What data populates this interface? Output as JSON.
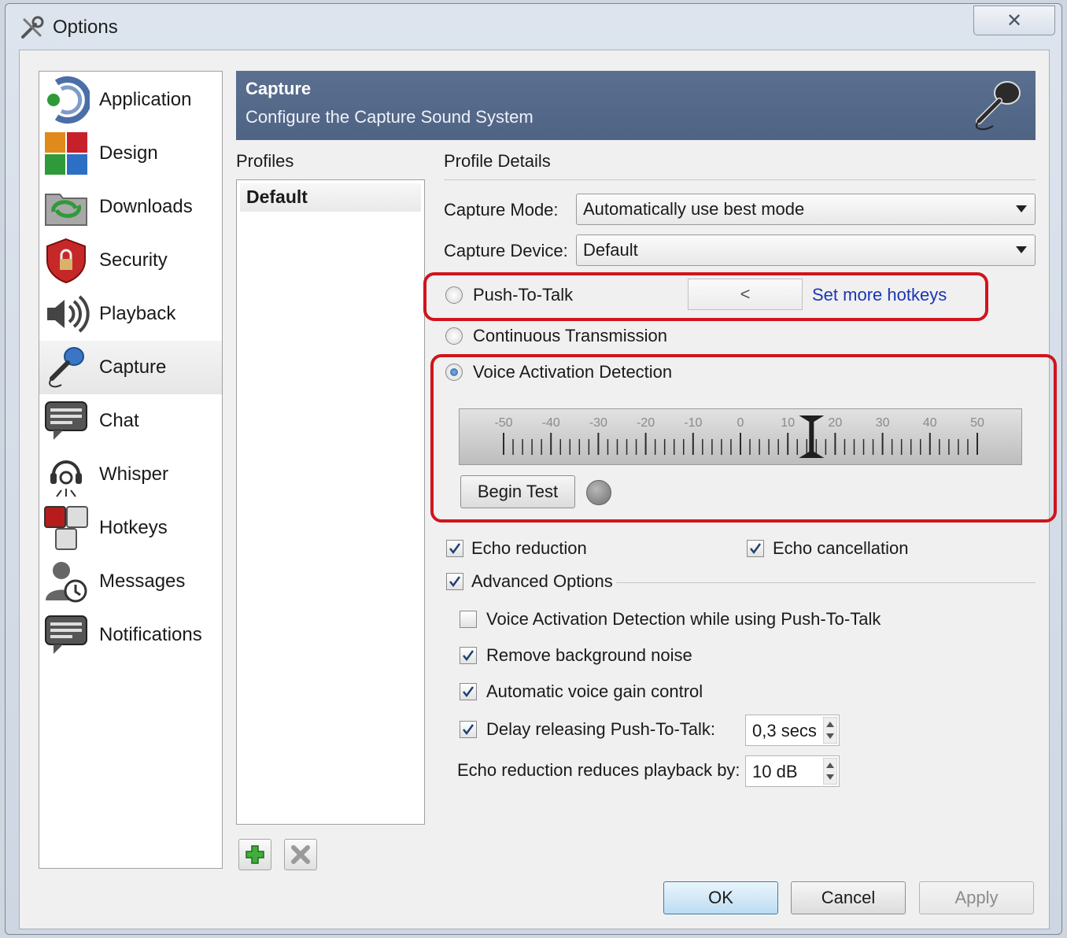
{
  "window": {
    "title": "Options",
    "close_glyph": "✕"
  },
  "sidebar": {
    "items": [
      {
        "label": "Application",
        "icon": "application-icon"
      },
      {
        "label": "Design",
        "icon": "design-icon"
      },
      {
        "label": "Downloads",
        "icon": "downloads-icon"
      },
      {
        "label": "Security",
        "icon": "security-icon"
      },
      {
        "label": "Playback",
        "icon": "playback-icon"
      },
      {
        "label": "Capture",
        "icon": "capture-microphone-icon",
        "selected": true
      },
      {
        "label": "Chat",
        "icon": "chat-icon"
      },
      {
        "label": "Whisper",
        "icon": "whisper-headset-icon"
      },
      {
        "label": "Hotkeys",
        "icon": "hotkeys-icon"
      },
      {
        "label": "Messages",
        "icon": "messages-icon"
      },
      {
        "label": "Notifications",
        "icon": "notifications-icon"
      }
    ]
  },
  "header": {
    "title": "Capture",
    "subtitle": "Configure the Capture Sound System"
  },
  "profiles": {
    "label": "Profiles",
    "items": [
      "Default"
    ]
  },
  "details": {
    "label": "Profile Details",
    "capture_mode": {
      "label": "Capture Mode:",
      "value": "Automatically use best mode"
    },
    "capture_device": {
      "label": "Capture Device:",
      "value": "Default"
    },
    "push_to_talk": {
      "label": "Push-To-Talk",
      "hotkey": "<",
      "link": "Set more hotkeys",
      "selected": false
    },
    "continuous": {
      "label": "Continuous Transmission",
      "selected": false
    },
    "vad": {
      "label": "Voice Activation Detection",
      "selected": true
    },
    "slider": {
      "ticks": [
        "-50",
        "-40",
        "-30",
        "-20",
        "-10",
        "0",
        "10",
        "20",
        "30",
        "40",
        "50"
      ],
      "value": 15
    },
    "begin_test": "Begin Test",
    "echo_reduction": {
      "label": "Echo reduction",
      "checked": true
    },
    "echo_cancellation": {
      "label": "Echo cancellation",
      "checked": true
    },
    "advanced": {
      "label": "Advanced Options",
      "checked": true
    },
    "adv_vad_ptt": {
      "label": "Voice Activation Detection while using Push-To-Talk",
      "checked": false
    },
    "remove_noise": {
      "label": "Remove background noise",
      "checked": true
    },
    "agc": {
      "label": "Automatic voice gain control",
      "checked": true
    },
    "delay_ptt": {
      "label": "Delay releasing Push-To-Talk:",
      "checked": true,
      "value": "0,3 secs"
    },
    "echo_playback": {
      "label": "Echo reduction reduces playback by:",
      "value": "10 dB"
    }
  },
  "buttons": {
    "ok": "OK",
    "cancel": "Cancel",
    "apply": "Apply"
  },
  "colors": {
    "header": "#52668a",
    "highlight_box": "#d0141c",
    "link": "#1b35b5"
  }
}
